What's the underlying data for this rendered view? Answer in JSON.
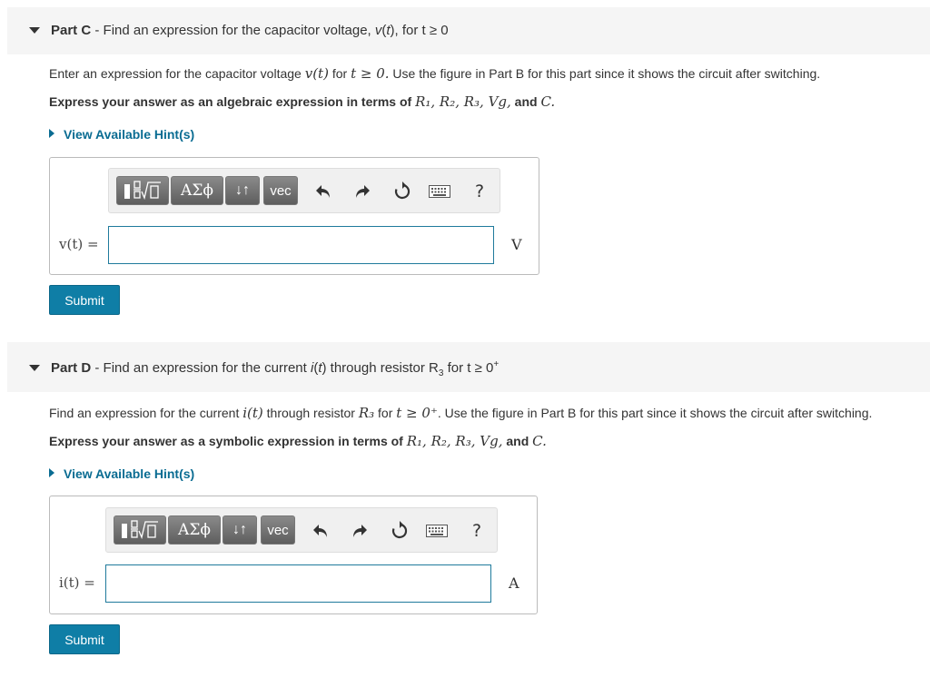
{
  "part_c": {
    "header_part": "Part C",
    "header_sep": " - ",
    "header_text": "Find an expression for the capacitor voltage, ",
    "header_var": "v",
    "header_var_t": "(t)",
    "header_rest": ", for t ≥ 0",
    "prompt_a": "Enter an expression for the capacitor voltage ",
    "prompt_math1": "v(t)",
    "prompt_b": " for ",
    "prompt_math2": "t ≥ 0.",
    "prompt_c": " Use the figure in Part B for this part since it shows the circuit after switching.",
    "instr_a": "Express your answer as an algebraic expression in terms of ",
    "instr_math": "R₁, R₂, R₃, Vg,",
    "instr_b": " and ",
    "instr_math2": "C.",
    "hint_label": "View Available Hint(s)",
    "answer_label": "v(t) =",
    "answer_value": "",
    "unit": "V",
    "submit_label": "Submit"
  },
  "part_d": {
    "header_part": "Part D",
    "header_sep": " - ",
    "header_text": "Find an expression for the current ",
    "header_var": "i",
    "header_var_t": "(t)",
    "header_mid": " through resistor R",
    "header_sub": "3",
    "header_rest": " for t ≥ 0",
    "header_sup": "+",
    "prompt_a": "Find an expression for the current ",
    "prompt_math1": "i(t)",
    "prompt_b": " through resistor ",
    "prompt_math2": "R₃",
    "prompt_c": " for ",
    "prompt_math3": "t ≥ 0⁺",
    "prompt_d": ". Use the figure in Part B for this part since it shows the circuit after switching.",
    "instr_a": "Express your answer as a symbolic expression in terms of ",
    "instr_math": "R₁, R₂, R₃, Vg,",
    "instr_b": " and ",
    "instr_math2": "C.",
    "hint_label": "View Available Hint(s)",
    "answer_label": "i(t) =",
    "answer_value": "",
    "unit": "A",
    "submit_label": "Submit"
  },
  "toolbar": {
    "greek_label": "ΑΣϕ",
    "arrows_label": "↓↑",
    "vec_label": "vec",
    "help_label": "?"
  },
  "icons": [
    "templates-icon",
    "undo-icon",
    "redo-icon",
    "reset-icon",
    "keyboard-icon",
    "help-icon"
  ]
}
